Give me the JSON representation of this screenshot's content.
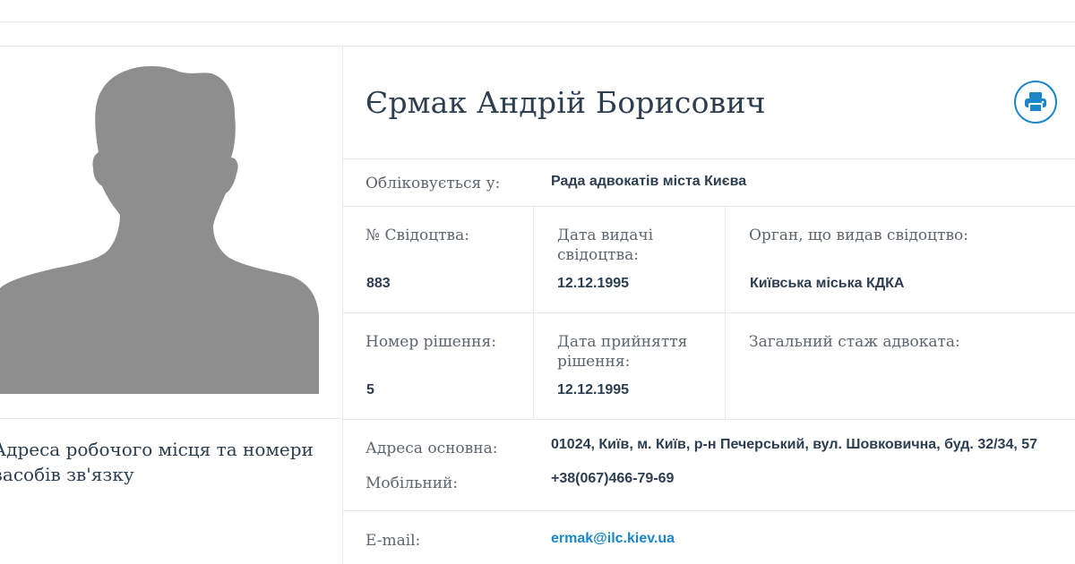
{
  "lawyer": {
    "name": "Єрмак Андрій Борисович"
  },
  "icons": {
    "print": "print-icon",
    "photo": "person-silhouette-icon"
  },
  "colors": {
    "accent": "#1b86c8",
    "text": "#2c3e50",
    "label": "#5d6670",
    "silhouette": "#8e8e8e",
    "divider": "#e6e9ec"
  },
  "registered": {
    "label": "Обліковується у:",
    "value": "Рада адвокатів міста Києва"
  },
  "certificate": {
    "number_label": "№ Свідоцтва:",
    "number_value": "883",
    "date_label": "Дата видачі свідоцтва:",
    "date_value": "12.12.1995",
    "issuer_label": "Орган, що видав свідоцтво:",
    "issuer_value": "Київська міська КДКА"
  },
  "decision": {
    "number_label": "Номер рішення:",
    "number_value": "5",
    "date_label": "Дата прийняття рішення:",
    "date_value": "12.12.1995",
    "experience_label": "Загальний стаж адвоката:",
    "experience_value": ""
  },
  "contacts": {
    "heading": "Адреса робочого місця та номери засобів зв'язку",
    "address_label": "Адреса основна:",
    "address_value": "01024, Київ, м. Київ, р-н Печерський, вул. Шовковична, буд. 32/34, 57",
    "mobile_label": "Мобільний:",
    "mobile_value": "+38(067)466-79-69",
    "email_label": "E-mail:",
    "email_value": "ermak@ilc.kiev.ua"
  }
}
